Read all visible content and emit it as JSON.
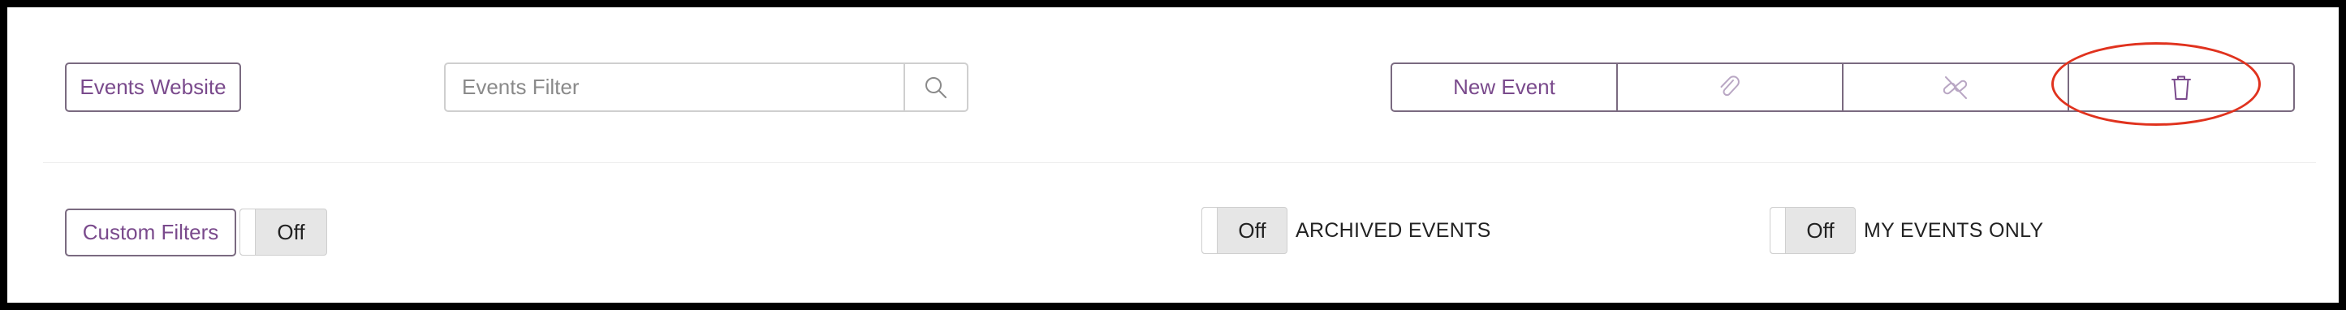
{
  "toolbar": {
    "events_website_label": "Events Website",
    "search": {
      "placeholder": "Events Filter",
      "value": ""
    },
    "actions": {
      "new_event_label": "New Event",
      "attach_icon": "paperclip-icon",
      "unlink_icon": "unlink-icon",
      "delete_icon": "trash-icon"
    }
  },
  "filters": {
    "custom_filters_label": "Custom Filters",
    "custom_filters_toggle": "Off",
    "archived": {
      "state": "Off",
      "label": "ARCHIVED EVENTS"
    },
    "my_events": {
      "state": "Off",
      "label": "MY EVENTS ONLY"
    }
  },
  "colors": {
    "accent": "#7a4a8c",
    "border": "#7a6a80",
    "highlight": "#e0321e",
    "toggle_bg": "#e6e6e6"
  }
}
